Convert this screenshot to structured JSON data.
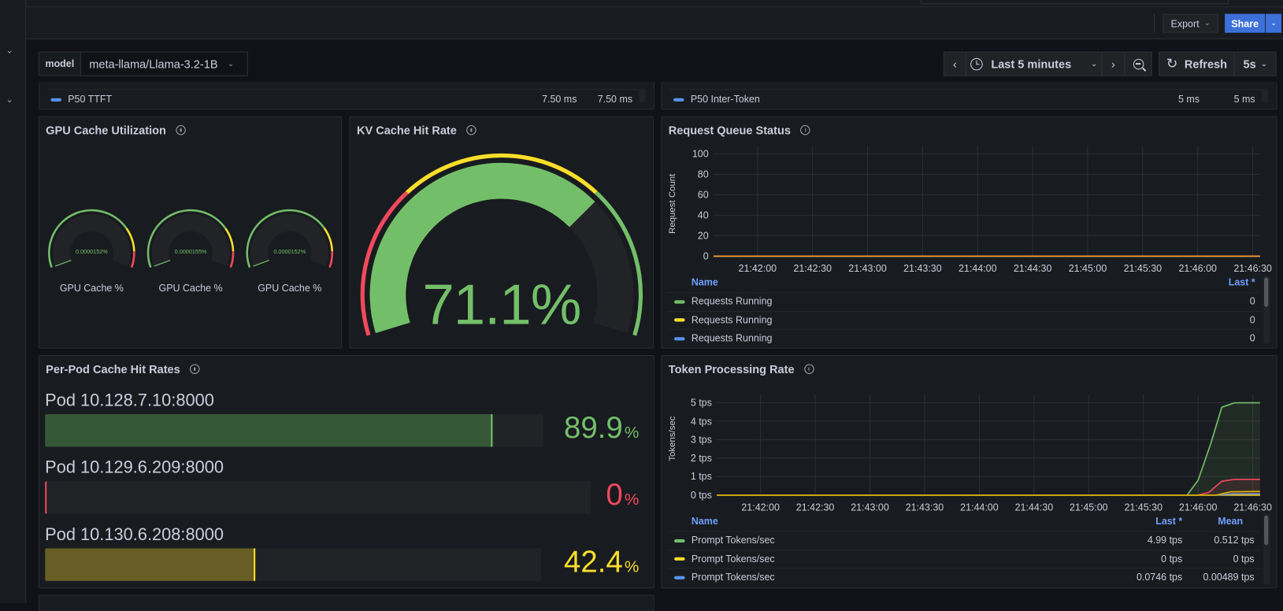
{
  "colors": {
    "green": "#73bf69",
    "yellow": "#fade2a",
    "red": "#f2495c",
    "blue": "#5794f2",
    "orange": "#ff9830",
    "accent": "#3d71d9"
  },
  "toolbar": {
    "export_label": "Export",
    "share_label": "Share"
  },
  "variables": {
    "model_label": "model",
    "model_value": "meta-llama/Llama-3.2-1B"
  },
  "time_controls": {
    "range": "Last 5 minutes",
    "refresh_label": "Refresh",
    "refresh_interval": "5s"
  },
  "partial_panels": [
    {
      "legend": "P50 TTFT",
      "color": "#5794f2",
      "values": [
        "7.50 ms",
        "7.50 ms"
      ]
    },
    {
      "legend": "P50 Inter-Token",
      "color": "#5794f2",
      "values": [
        "5 ms",
        "5 ms"
      ]
    }
  ],
  "gpu_cache": {
    "title": "GPU Cache Utilization",
    "min": 0,
    "max": 100,
    "thresholds": [
      {
        "from": 0,
        "color": "#73bf69"
      },
      {
        "from": 75,
        "color": "#fade2a"
      },
      {
        "from": 90,
        "color": "#f2495c"
      }
    ],
    "gauges": [
      {
        "value": 1.52e-05,
        "display": "0.0000152%",
        "label": "GPU Cache %"
      },
      {
        "value": 1.55e-05,
        "display": "0.0000155%",
        "label": "GPU Cache %"
      },
      {
        "value": 1.52e-05,
        "display": "0.0000152%",
        "label": "GPU Cache %"
      }
    ]
  },
  "kv_cache": {
    "title": "KV Cache Hit Rate",
    "value": 71.1,
    "display": "71.1%",
    "min": 0,
    "max": 100,
    "thresholds": [
      {
        "from": 0,
        "color": "#f2495c"
      },
      {
        "from": 30,
        "color": "#fade2a"
      },
      {
        "from": 70,
        "color": "#73bf69"
      }
    ]
  },
  "per_pod": {
    "title": "Per-Pod Cache Hit Rates",
    "pods": [
      {
        "label": "Pod 10.128.7.10:8000",
        "value": 89.9,
        "number": "89.9",
        "unit": "%",
        "color": "#73bf69",
        "fill": "#355837"
      },
      {
        "label": "Pod 10.129.6.209:8000",
        "value": 0,
        "number": "0",
        "unit": "%",
        "color": "#f2495c",
        "fill": "#5a2a30"
      },
      {
        "label": "Pod 10.130.6.208:8000",
        "value": 42.4,
        "number": "42.4",
        "unit": "%",
        "color": "#fade2a",
        "fill": "#665e24"
      }
    ]
  },
  "chart_data": [
    {
      "type": "line",
      "title": "Request Queue Status",
      "ylabel": "Request Count",
      "ylim": [
        0,
        100
      ],
      "yticks": [
        "0",
        "20",
        "40",
        "60",
        "80",
        "100"
      ],
      "xlim": [
        "21:41:36",
        "21:46:34"
      ],
      "xticks": [
        "21:42:00",
        "21:42:30",
        "21:43:00",
        "21:43:30",
        "21:44:00",
        "21:44:30",
        "21:45:00",
        "21:45:30",
        "21:46:00",
        "21:46:30"
      ],
      "grid": true,
      "legend": {
        "placement": "bottom",
        "columns": [
          "Name",
          "Last *"
        ]
      },
      "series": [
        {
          "name": "Requests Running",
          "color": "#73bf69",
          "last": "0",
          "x": [
            "21:41:36",
            "21:46:34"
          ],
          "y": [
            0,
            0
          ]
        },
        {
          "name": "Requests Running",
          "color": "#fade2a",
          "last": "0",
          "x": [
            "21:41:36",
            "21:46:34"
          ],
          "y": [
            0,
            0
          ]
        },
        {
          "name": "Requests Running",
          "color": "#5794f2",
          "last": "0",
          "x": [
            "21:41:36",
            "21:46:34"
          ],
          "y": [
            0,
            0
          ]
        },
        {
          "color": "#ff9830",
          "x": [
            "21:41:36",
            "21:46:34"
          ],
          "y": [
            0,
            0
          ]
        }
      ]
    },
    {
      "type": "area",
      "title": "Token Processing Rate",
      "ylabel": "Tokens/sec",
      "ylim": [
        0,
        5
      ],
      "yticks": [
        "0 tps",
        "1 tps",
        "2 tps",
        "3 tps",
        "4 tps",
        "5 tps"
      ],
      "xlim": [
        "21:41:36",
        "21:46:34"
      ],
      "xticks": [
        "21:42:00",
        "21:42:30",
        "21:43:00",
        "21:43:30",
        "21:44:00",
        "21:44:30",
        "21:45:00",
        "21:45:30",
        "21:46:00",
        "21:46:30"
      ],
      "grid": true,
      "legend": {
        "placement": "bottom",
        "columns": [
          "Name",
          "Last *",
          "Mean"
        ]
      },
      "series": [
        {
          "name": "Prompt Tokens/sec",
          "color": "#73bf69",
          "last": "4.99 tps",
          "mean": "0.512 tps",
          "x": [
            "21:41:36",
            "21:45:54",
            "21:46:00",
            "21:46:07",
            "21:46:13",
            "21:46:20",
            "21:46:34"
          ],
          "y": [
            0,
            0,
            0.8,
            2.8,
            4.75,
            4.99,
            4.99
          ]
        },
        {
          "name": "Prompt Tokens/sec",
          "color": "#fade2a",
          "last": "0 tps",
          "mean": "0 tps",
          "x": [
            "21:41:36",
            "21:46:34"
          ],
          "y": [
            0,
            0
          ]
        },
        {
          "name": "Prompt Tokens/sec",
          "color": "#5794f2",
          "last": "0.0746 tps",
          "mean": "0.00489 tps",
          "x": [
            "21:41:36",
            "21:46:10",
            "21:46:20",
            "21:46:34"
          ],
          "y": [
            0,
            0,
            0.0746,
            0.0746
          ]
        },
        {
          "color": "#f2495c",
          "x": [
            "21:41:36",
            "21:46:00",
            "21:46:06",
            "21:46:13",
            "21:46:20",
            "21:46:34"
          ],
          "y": [
            0,
            0,
            0.15,
            0.75,
            0.85,
            0.85
          ]
        },
        {
          "color": "#e0b400",
          "x": [
            "21:41:36",
            "21:46:10",
            "21:46:18",
            "21:46:34"
          ],
          "y": [
            0,
            0,
            0.18,
            0.2
          ]
        }
      ]
    }
  ]
}
